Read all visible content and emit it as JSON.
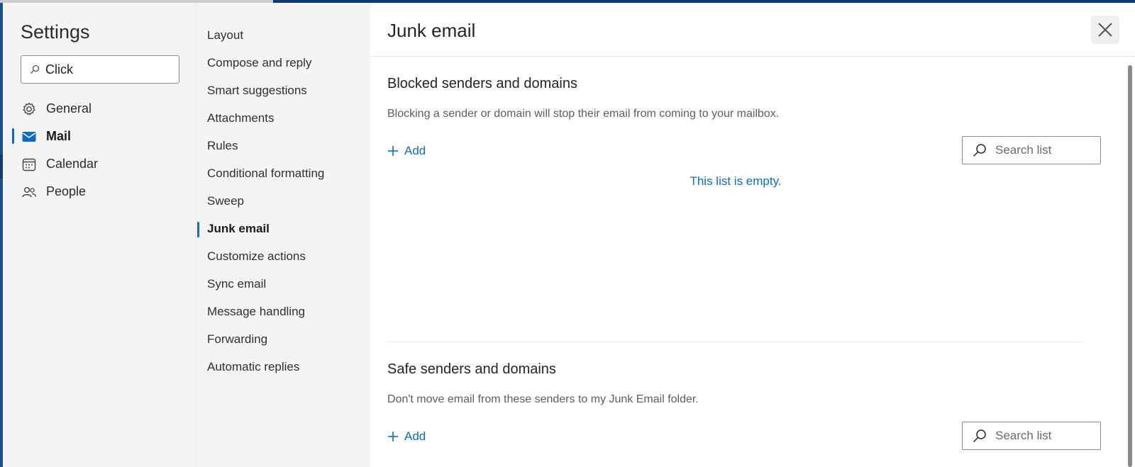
{
  "sidebar": {
    "title": "Settings",
    "search": {
      "value": "Click"
    },
    "categories": [
      {
        "label": "General",
        "icon": "gear-icon"
      },
      {
        "label": "Mail",
        "icon": "mail-icon",
        "selected": true
      },
      {
        "label": "Calendar",
        "icon": "calendar-icon"
      },
      {
        "label": "People",
        "icon": "people-icon"
      }
    ]
  },
  "submenu": {
    "items": [
      {
        "label": "Layout"
      },
      {
        "label": "Compose and reply"
      },
      {
        "label": "Smart suggestions"
      },
      {
        "label": "Attachments"
      },
      {
        "label": "Rules"
      },
      {
        "label": "Conditional formatting"
      },
      {
        "label": "Sweep"
      },
      {
        "label": "Junk email",
        "selected": true
      },
      {
        "label": "Customize actions"
      },
      {
        "label": "Sync email"
      },
      {
        "label": "Message handling"
      },
      {
        "label": "Forwarding"
      },
      {
        "label": "Automatic replies"
      }
    ]
  },
  "pane": {
    "title": "Junk email",
    "close_icon": "close-icon",
    "blocked": {
      "title": "Blocked senders and domains",
      "description": "Blocking a sender or domain will stop their email from coming to your mailbox.",
      "add_label": "Add",
      "search_placeholder": "Search list",
      "empty_text": "This list is empty."
    },
    "safe": {
      "title": "Safe senders and domains",
      "description": "Don't move email from these senders to my Junk Email folder.",
      "add_label": "Add",
      "search_placeholder": "Search list"
    }
  },
  "colors": {
    "accent": "#0f6cbd",
    "sidebar_bg": "#f4f4f4",
    "backdrop": "#1a4f8c"
  }
}
